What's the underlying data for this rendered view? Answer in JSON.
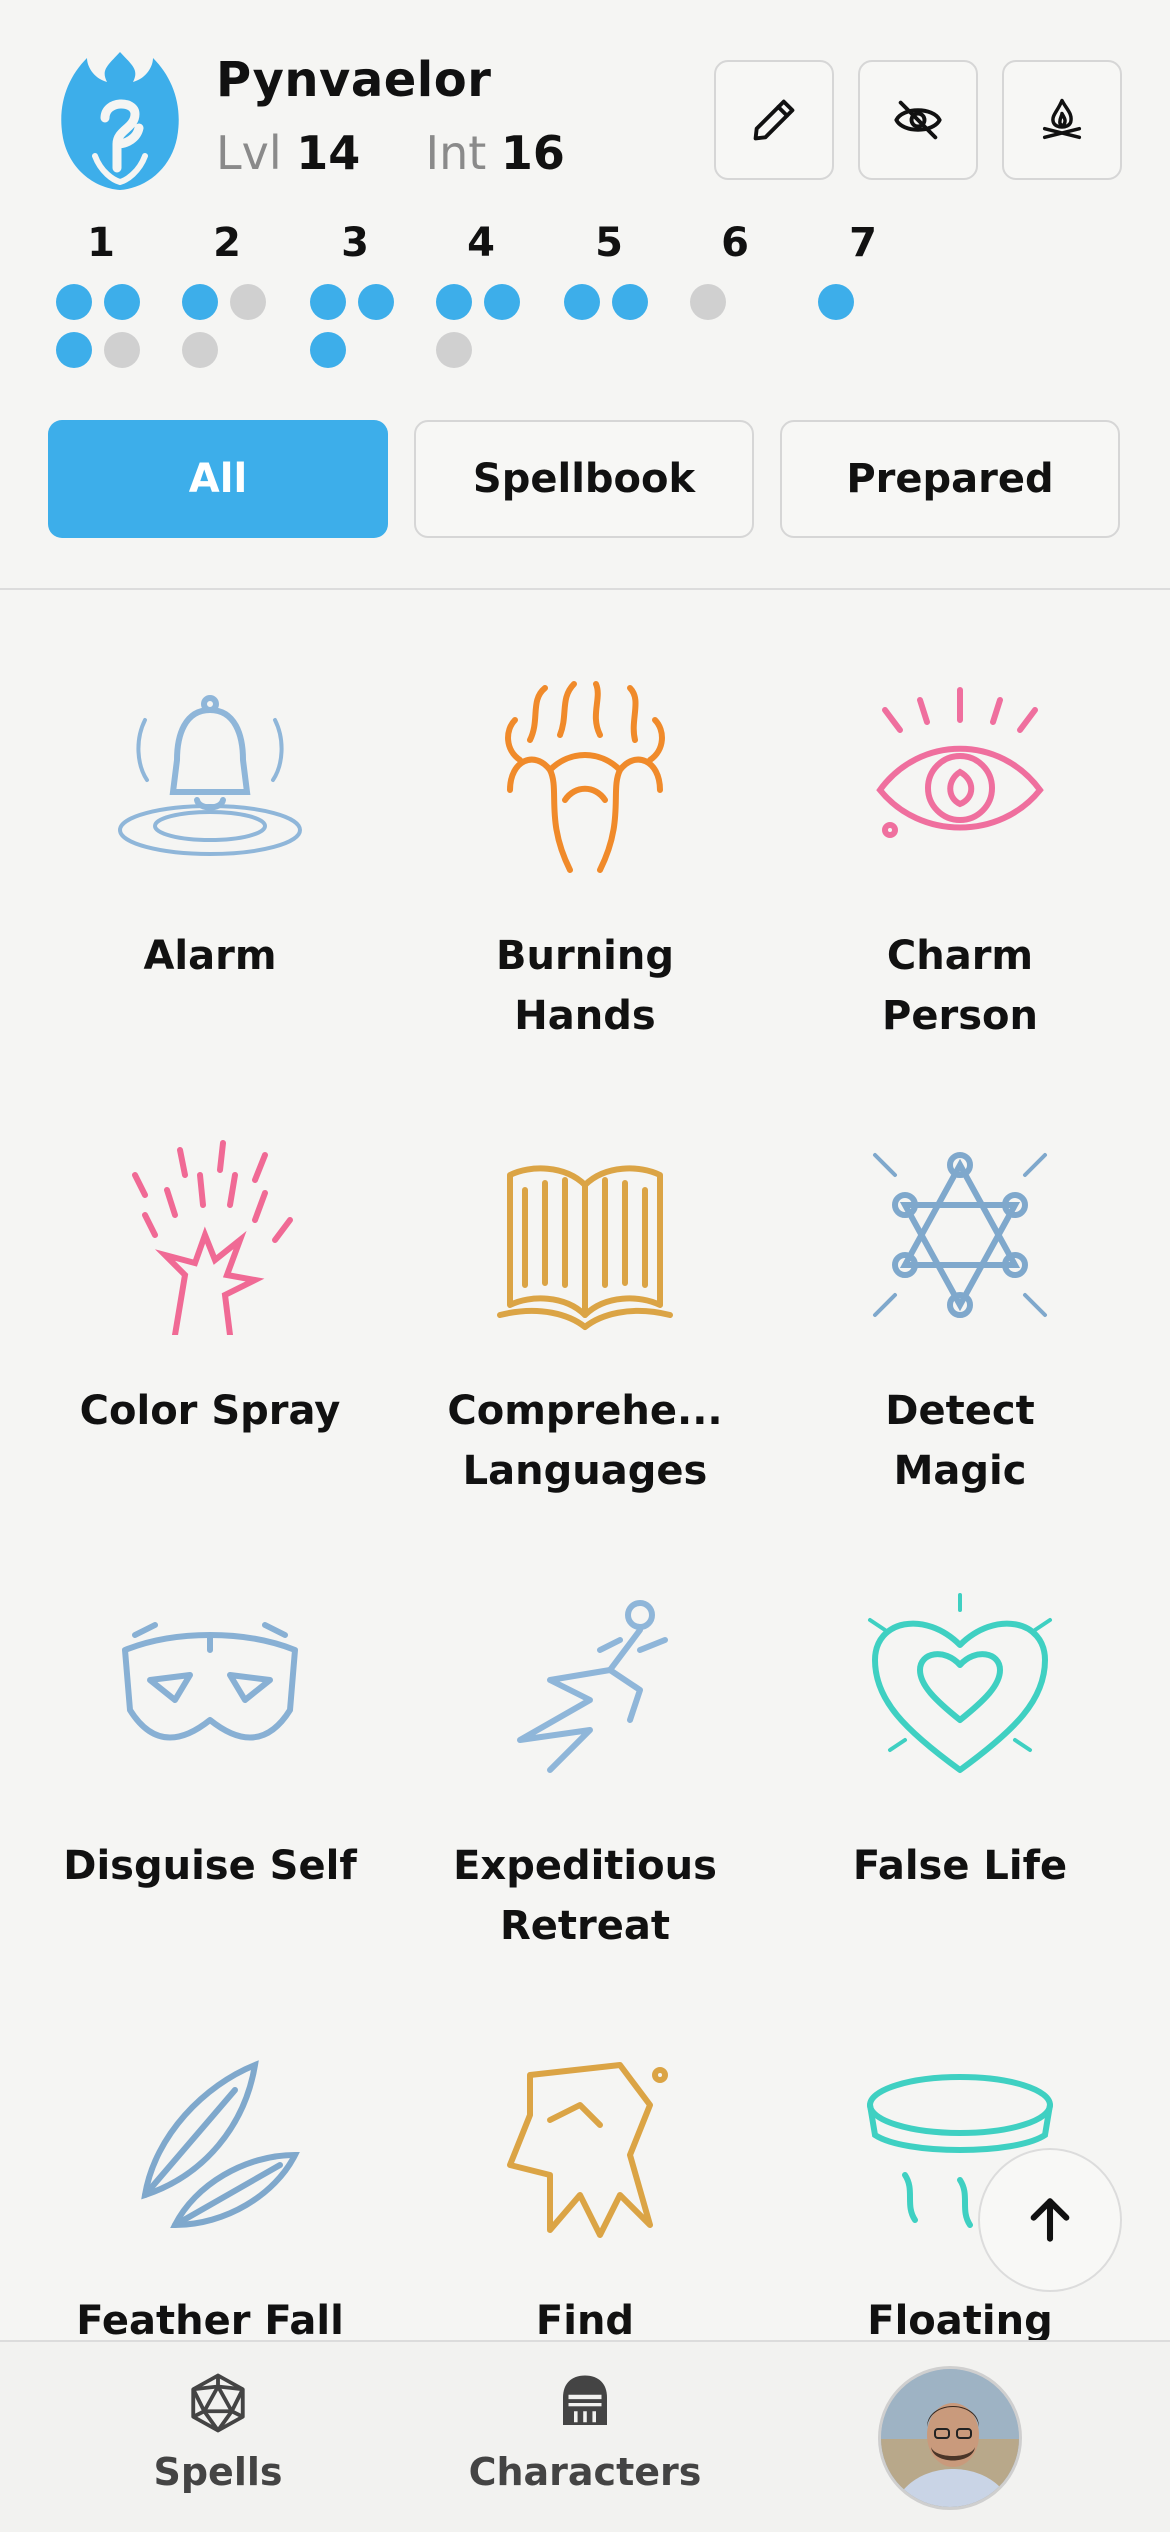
{
  "character": {
    "name": "Pynvaelor",
    "level_label": "Lvl",
    "level": "14",
    "int_label": "Int",
    "int": "16"
  },
  "header_actions": [
    {
      "icon": "pencil-icon"
    },
    {
      "icon": "eye-off-icon"
    },
    {
      "icon": "campfire-icon"
    }
  ],
  "spell_slots": [
    {
      "level": "1",
      "dots": [
        true,
        true,
        true,
        false
      ]
    },
    {
      "level": "2",
      "dots": [
        true,
        false,
        false
      ]
    },
    {
      "level": "3",
      "dots": [
        true,
        true,
        true
      ]
    },
    {
      "level": "4",
      "dots": [
        true,
        true,
        false
      ]
    },
    {
      "level": "5",
      "dots": [
        true,
        true
      ]
    },
    {
      "level": "6",
      "dots": [
        false
      ]
    },
    {
      "level": "7",
      "dots": [
        true
      ]
    }
  ],
  "filters": [
    {
      "label": "All",
      "active": true
    },
    {
      "label": "Spellbook",
      "active": false
    },
    {
      "label": "Prepared",
      "active": false
    }
  ],
  "spells": [
    {
      "line1": "Alarm",
      "line2": "",
      "icon": "bell-icon",
      "color": "#8fb6d9"
    },
    {
      "line1": "Burning",
      "line2": "Hands",
      "icon": "flame-hands-icon",
      "color": "#f08a2a"
    },
    {
      "line1": "Charm",
      "line2": "Person",
      "icon": "eye-icon",
      "color": "#ef6f9e"
    },
    {
      "line1": "Color Spray",
      "line2": "",
      "icon": "spray-hand-icon",
      "color": "#f06a95"
    },
    {
      "line1": "Comprehe...",
      "line2": "Languages",
      "icon": "book-icon",
      "color": "#dba445"
    },
    {
      "line1": "Detect",
      "line2": "Magic",
      "icon": "hexagram-icon",
      "color": "#7fa8cc"
    },
    {
      "line1": "Disguise Self",
      "line2": "",
      "icon": "mask-icon",
      "color": "#88b0d4"
    },
    {
      "line1": "Expeditious",
      "line2": "Retreat",
      "icon": "running-figure-icon",
      "color": "#8fb6d9"
    },
    {
      "line1": "False Life",
      "line2": "",
      "icon": "thorn-heart-icon",
      "color": "#3fd0c2"
    },
    {
      "line1": "Feather Fall",
      "line2": "",
      "icon": "feathers-icon",
      "color": "#7fa8cc"
    },
    {
      "line1": "Find",
      "line2": "",
      "icon": "familiar-cat-icon",
      "color": "#dba445"
    },
    {
      "line1": "Floating",
      "line2": "",
      "icon": "floating-disk-icon",
      "color": "#3fd0c2"
    }
  ],
  "nav": {
    "spells_label": "Spells",
    "characters_label": "Characters"
  },
  "colors": {
    "accent": "#3daeea",
    "slot_empty": "#d0d0d0",
    "background": "#f5f5f3"
  }
}
